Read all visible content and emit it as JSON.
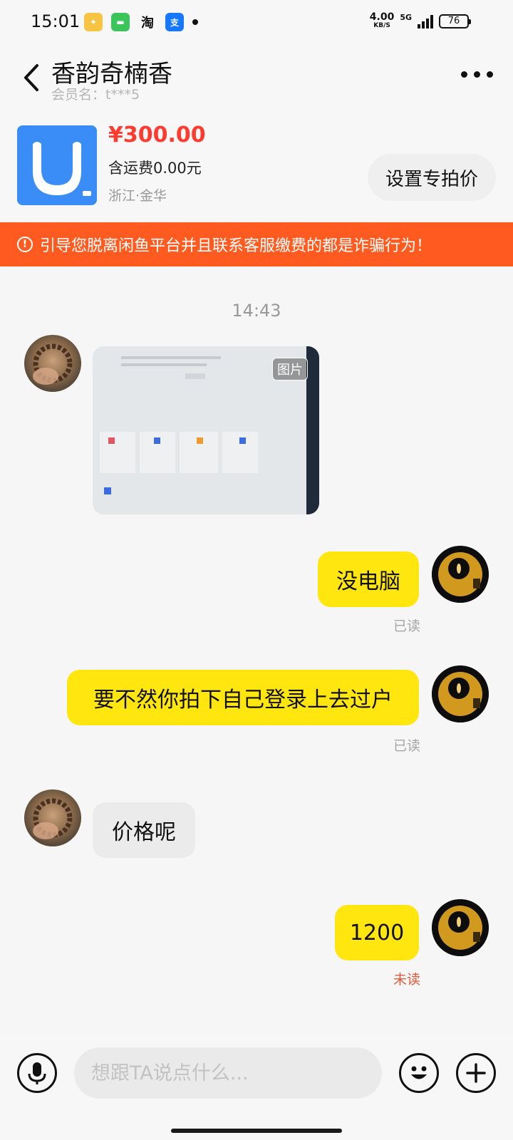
{
  "status_bar": {
    "time": "15:01",
    "notifications": [
      "taopiaopiao-app-icon",
      "messages-app-icon",
      "taobao-app-icon",
      "alipay-app-icon"
    ],
    "net_speed": "4.00",
    "net_speed_unit": "KB/S",
    "network": "5G",
    "battery": "76"
  },
  "header": {
    "title": "香韵奇楠香",
    "member": "会员名：t***5"
  },
  "product": {
    "price": "¥300.00",
    "shipping": "含运费0.00元",
    "location": "浙江·金华",
    "special_price_button": "设置专拍价"
  },
  "warning": {
    "text": "引导您脱离闲鱼平台并且联系客服缴费的都是诈骗行为！"
  },
  "chat": {
    "timestamp": "14:43",
    "image_tag": "图片",
    "messages": [
      {
        "text": "没电脑",
        "status": "已读"
      },
      {
        "text": "要不然你拍下自己登录上去过户",
        "status": "已读"
      },
      {
        "text": "价格呢"
      },
      {
        "text": "1200",
        "status": "未读"
      }
    ]
  },
  "input": {
    "placeholder": "想跟TA说点什么..."
  },
  "colors": {
    "accent_yellow": "#ffe60f",
    "warning_orange": "#ff5a1f",
    "price_red": "#ff3b30",
    "unread_red": "#e2583b"
  }
}
